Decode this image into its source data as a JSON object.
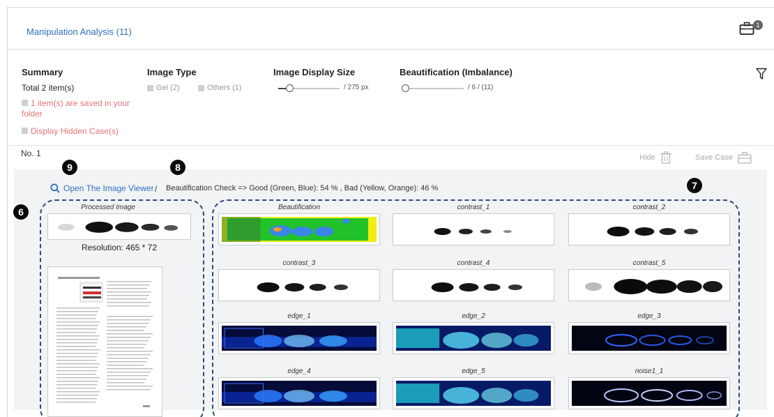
{
  "header": {
    "title": "Manipulation Analysis (11)",
    "case_count": "1"
  },
  "filters": {
    "summary": {
      "title": "Summary",
      "total": "Total 2 item(s)",
      "saved": "1 item(s) are saved in your folder",
      "hidden": "Display Hidden Case(s)"
    },
    "image_type": {
      "title": "Image Type",
      "options": [
        "Gel (2)",
        "Others (1)"
      ]
    },
    "display_size": {
      "title": "Image Display Size",
      "value_text": "/ 275 px",
      "level": 0.18
    },
    "beautification": {
      "title": "Beautification (Imbalance)",
      "value_text": "/ 6 / (11)",
      "level": 0.05
    }
  },
  "case": {
    "number": "No. 1",
    "hide_label": "Hide",
    "save_label": "Save Case",
    "viewer_link": "Open The Image Viewer",
    "separator": "/",
    "check_text": "Beautification Check => Good (Green, Blue): 54 % ,  Bad (Yellow, Orange): 46 %",
    "processed_label": "Processed Image",
    "resolution": "Resolution: 465 * 72",
    "thumbnails": [
      {
        "label": "Beautification",
        "style": "beautify"
      },
      {
        "label": "contrast_1",
        "style": "contrast-light"
      },
      {
        "label": "contrast_2",
        "style": "contrast"
      },
      {
        "label": "contrast_3",
        "style": "contrast"
      },
      {
        "label": "contrast_4",
        "style": "contrast"
      },
      {
        "label": "contrast_5",
        "style": "contrast-heavy"
      },
      {
        "label": "edge_1",
        "style": "edge"
      },
      {
        "label": "edge_2",
        "style": "edge-bright"
      },
      {
        "label": "edge_3",
        "style": "edge-dark"
      },
      {
        "label": "edge_4",
        "style": "edge"
      },
      {
        "label": "edge_5",
        "style": "edge-bright"
      },
      {
        "label": "noise1_1",
        "style": "noise"
      }
    ]
  },
  "markers": [
    "9",
    "8",
    "7",
    "6"
  ],
  "colors": {
    "link": "#2f6fbd",
    "alert": "#e8757a",
    "dash": "#2f4a78",
    "panel": "#f2f3f5"
  }
}
